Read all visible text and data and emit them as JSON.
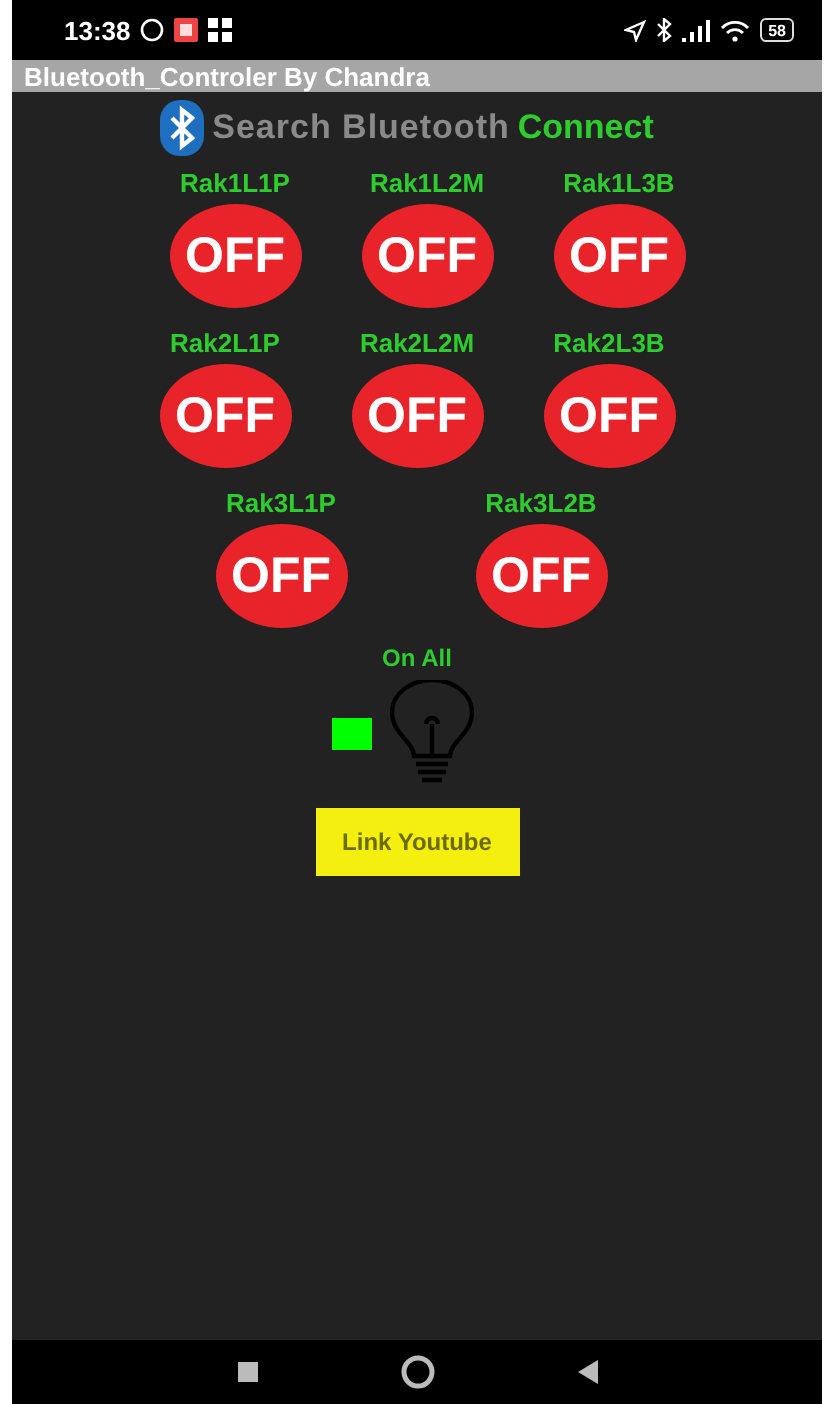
{
  "status_bar": {
    "time": "13:38",
    "battery": "58"
  },
  "window": {
    "title": "Bluetooth_Controler By Chandra"
  },
  "toolbar": {
    "search": "Search Bluetooth",
    "connect": "Connect"
  },
  "rows": [
    [
      {
        "label": "Rak1L1P",
        "button": "OFF"
      },
      {
        "label": "Rak1L2M",
        "button": "OFF"
      },
      {
        "label": "Rak1L3B",
        "button": "OFF"
      }
    ],
    [
      {
        "label": "Rak2L1P",
        "button": "OFF"
      },
      {
        "label": "Rak2L2M",
        "button": "OFF"
      },
      {
        "label": "Rak2L3B",
        "button": "OFF"
      }
    ],
    [
      {
        "label": "Rak3L1P",
        "button": "OFF"
      },
      {
        "label": "Rak3L2B",
        "button": "OFF"
      }
    ]
  ],
  "on_all": {
    "label": "On All"
  },
  "link_button": "Link Youtube"
}
